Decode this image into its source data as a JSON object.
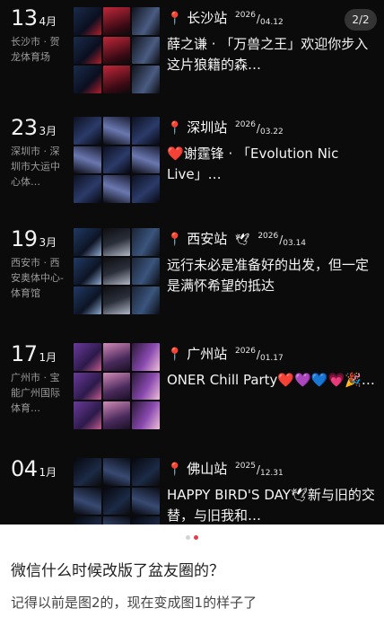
{
  "pager": {
    "label": "2/2"
  },
  "entries": [
    {
      "day": "13",
      "month": "4月",
      "location": "长沙市 · 贺龙体育场",
      "station": "长沙站",
      "stamp": {
        "year": "2026",
        "md": "04.12"
      },
      "text": "薛之谦 · 「万兽之王」欢迎你步入这片狼籍的森…"
    },
    {
      "day": "23",
      "month": "3月",
      "location": "深圳市 · 深圳市大运中心体…",
      "station": "深圳站",
      "stamp": {
        "year": "2026",
        "md": "03.22"
      },
      "text": "❤️谢霆锋 · 「Evolution Nic Live」…"
    },
    {
      "day": "19",
      "month": "3月",
      "location": "西安市 · 西安奥体中心-体育馆",
      "station": "西安站",
      "stamp": {
        "year": "2026",
        "md": "03.14"
      },
      "text": "远行未必是准备好的出发，但一定是满怀希望的抵达"
    },
    {
      "day": "17",
      "month": "1月",
      "location": "广州市 · 宝能广州国际体育…",
      "station": "广州站",
      "stamp": {
        "year": "2026",
        "md": "01.17"
      },
      "text": "ONER Chill Party❤️💜💙💗🎉…"
    },
    {
      "day": "04",
      "month": "1月",
      "location": "",
      "station": "佛山站",
      "stamp": {
        "year": "2025",
        "md": "12.31"
      },
      "text": "HAPPY BIRD'S DAY🕊新与旧的交替，与旧我和…"
    }
  ],
  "pagination": {
    "count": 2,
    "active": 1
  },
  "post": {
    "title": "微信什么时候改版了盆友圈的？",
    "body": "记得以前是图2的，现在变成图1的样子了"
  },
  "colors": {
    "pin": "#e2354a",
    "dot_active": "#e0404e",
    "background_dark": "#0b0b0b"
  },
  "icons": {
    "pin": "location-pin-icon",
    "ghost": "ghost-icon"
  }
}
